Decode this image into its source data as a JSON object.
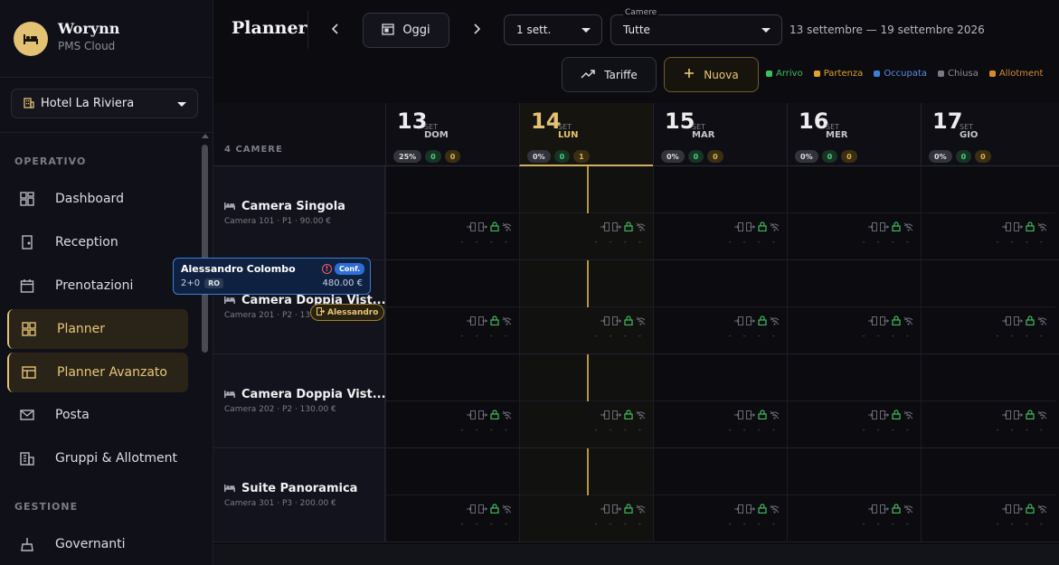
{
  "brand": {
    "name": "Worynn",
    "subtitle": "PMS Cloud",
    "accent": "#e3c274"
  },
  "hotel_select": {
    "value": "Hotel La Riviera"
  },
  "sidebar": {
    "sections": [
      {
        "label": "OPERATIVO"
      },
      {
        "label": "GESTIONE"
      }
    ],
    "items": [
      {
        "label": "Dashboard",
        "icon": "dashboard-icon",
        "active": false
      },
      {
        "label": "Reception",
        "icon": "reception-icon",
        "active": false
      },
      {
        "label": "Prenotazioni",
        "icon": "calendar-icon",
        "active": false
      },
      {
        "label": "Planner",
        "icon": "grid-icon",
        "active": true
      },
      {
        "label": "Planner Avanzato",
        "icon": "layout-icon",
        "active": true
      },
      {
        "label": "Posta",
        "icon": "mail-icon",
        "active": false
      },
      {
        "label": "Gruppi & Allotment",
        "icon": "building-icon",
        "active": false
      },
      {
        "label": "Governanti",
        "icon": "broom-icon",
        "active": false
      }
    ]
  },
  "header": {
    "title": "Planner",
    "today_label": "Oggi",
    "period_select": "1 sett.",
    "rooms_caption": "Camere",
    "rooms_select": "Tutte",
    "date_range": "13 settembre — 19 settembre 2026",
    "tariffe_label": "Tariffe",
    "nuova_label": "Nuova"
  },
  "legend": [
    {
      "label": "Arrivo",
      "color": "#3fbf5f"
    },
    {
      "label": "Partenza",
      "color": "#e0a12e"
    },
    {
      "label": "Occupata",
      "color": "#3d7dd6"
    },
    {
      "label": "Chiusa",
      "color": "#7a7a84"
    },
    {
      "label": "Allotment",
      "color": "#d98a2e"
    }
  ],
  "grid": {
    "room_count_label": "4 CAMERE",
    "days": [
      {
        "num": "13",
        "month": "SET",
        "weekday": "DOM",
        "occupancy": "25%",
        "arrivals": "0",
        "departures": "0",
        "today": false
      },
      {
        "num": "14",
        "month": "SET",
        "weekday": "LUN",
        "occupancy": "0%",
        "arrivals": "0",
        "departures": "1",
        "today": true
      },
      {
        "num": "15",
        "month": "SET",
        "weekday": "MAR",
        "occupancy": "0%",
        "arrivals": "0",
        "departures": "0",
        "today": false
      },
      {
        "num": "16",
        "month": "SET",
        "weekday": "MER",
        "occupancy": "0%",
        "arrivals": "0",
        "departures": "0",
        "today": false
      },
      {
        "num": "17",
        "month": "SET",
        "weekday": "GIO",
        "occupancy": "0%",
        "arrivals": "0",
        "departures": "0",
        "today": false
      }
    ],
    "rooms": [
      {
        "name": "Camera Singola",
        "meta": "Camera 101 · P1 · 90.00 €"
      },
      {
        "name": "Camera Doppia Vist...",
        "meta": "Camera 201 · P2 · 130.00 €"
      },
      {
        "name": "Camera Doppia Vist...",
        "meta": "Camera 202 · P2 · 130.00 €"
      },
      {
        "name": "Suite Panoramica",
        "meta": "Camera 301 · P3 · 200.00 €"
      }
    ],
    "cell_dashes": "- - - -"
  },
  "booking": {
    "guest": "Alessandro Colombo",
    "status": "Conf.",
    "guests": "2+0",
    "board": "RO",
    "price": "480.00 €",
    "checkout_label": "Alessandro"
  }
}
